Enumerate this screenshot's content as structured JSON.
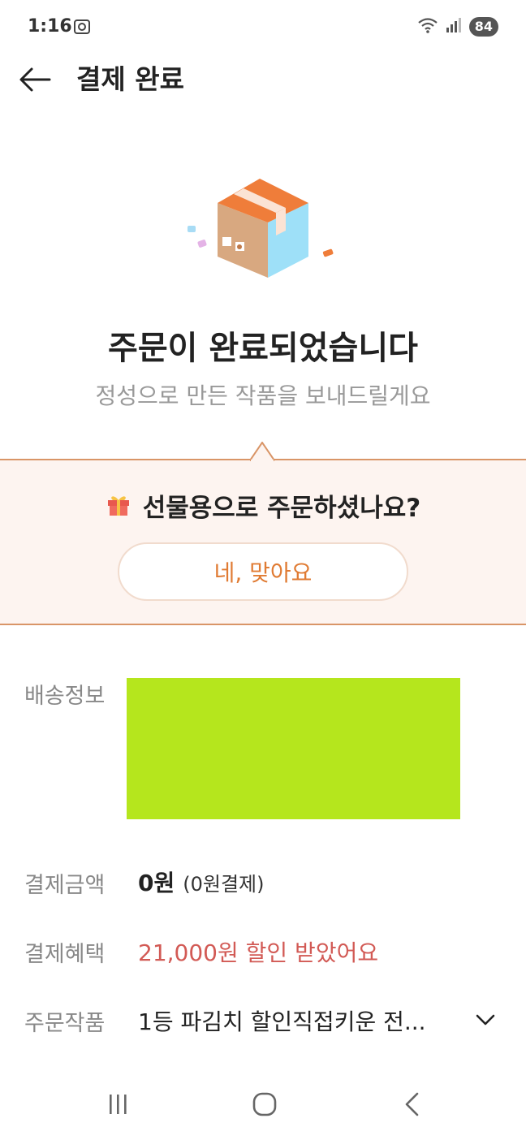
{
  "status_bar": {
    "time": "1:16",
    "battery": "84",
    "icons": [
      "camera-icon",
      "wifi-icon",
      "signal-icon",
      "battery-icon"
    ]
  },
  "header": {
    "title": "결제 완료",
    "back_icon": "arrow-left-icon"
  },
  "hero": {
    "title": "주문이 완료되었습니다",
    "subtitle": "정성으로 만든 작품을 보내드릴게요",
    "illustration": "package-box-icon"
  },
  "gift": {
    "question": "선물용으로 주문하셨나요?",
    "button_label": "네, 맞아요",
    "icon": "gift-icon"
  },
  "info": {
    "delivery_label": "배송정보",
    "amount_label": "결제금액",
    "amount_value": "0원",
    "amount_note": "(0원결제)",
    "benefit_label": "결제혜택",
    "benefit_value": "21,000원 할인 받았어요",
    "product_label": "주문작품",
    "product_value": "1등 파김치 할인직접키운 전...",
    "expand_icon": "chevron-down-icon"
  },
  "colors": {
    "accent": "#e07b33",
    "discount": "#d25a55",
    "gift_bg": "#fdf4f0",
    "redacted": "#b5e61d"
  },
  "nav_bar": {
    "icons": [
      "recent-apps-icon",
      "home-icon",
      "back-icon"
    ]
  }
}
